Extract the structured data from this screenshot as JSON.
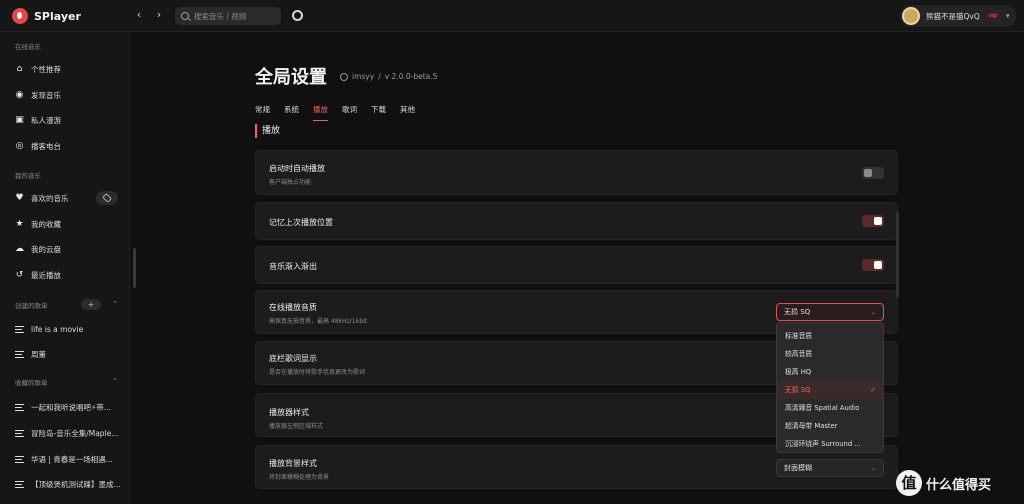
{
  "app": {
    "name": "SPlayer"
  },
  "search": {
    "placeholder": "搜索音乐 / 视频"
  },
  "user": {
    "name": "熊猫不是猫QvQ",
    "badge": "vip"
  },
  "sidebar": {
    "online_title": "在线音乐",
    "online_items": [
      {
        "label": "个性推荐",
        "icon": "home-icon"
      },
      {
        "label": "发现音乐",
        "icon": "compass-icon"
      },
      {
        "label": "私人漫游",
        "icon": "radio-icon"
      },
      {
        "label": "播客电台",
        "icon": "podcast-icon"
      }
    ],
    "mine_title": "我的音乐",
    "mine_items": [
      {
        "label": "喜欢的音乐",
        "icon": "heart-icon"
      },
      {
        "label": "我的收藏",
        "icon": "star-icon"
      },
      {
        "label": "我的云盘",
        "icon": "cloud-icon"
      },
      {
        "label": "最近播放",
        "icon": "history-icon"
      }
    ],
    "created_title": "创建的歌单",
    "created_items": [
      {
        "label": "life is a movie"
      },
      {
        "label": "周董"
      }
    ],
    "collected_title": "收藏的歌单",
    "collected_items": [
      {
        "label": "一起和我听说唱吧⚡带..."
      },
      {
        "label": "冒险岛-音乐全集/Maple..."
      },
      {
        "label": "华语 | 青春是一场相遇..."
      },
      {
        "label": "【顶级煲机测试碟】墨成..."
      }
    ]
  },
  "page": {
    "title": "全局设置",
    "author": "imsyy",
    "version": "v 2.0.0-beta.5",
    "tabs": [
      "常规",
      "系统",
      "播放",
      "歌词",
      "下载",
      "其他"
    ],
    "active_tab": 2,
    "section": "播放"
  },
  "settings": [
    {
      "title": "启动时自动播放",
      "desc": "客户端独占功能",
      "toggle": false
    },
    {
      "title": "记忆上次播放位置",
      "toggle": true
    },
    {
      "title": "音乐渐入渐出",
      "toggle": true
    },
    {
      "title": "在线播放音质",
      "desc": "高保真无损音质，最高 48kHz/16bit",
      "select": "无损 SQ"
    },
    {
      "title": "底栏歌词显示",
      "desc": "是否在播放时将歌手信息更改为歌词"
    },
    {
      "title": "播放器样式",
      "desc": "播放器左侧区域样式"
    },
    {
      "title": "播放背景样式",
      "desc": "将封面模糊处理为背景",
      "select": "封面模糊"
    }
  ],
  "quality_options": [
    "标准音质",
    "较高音质",
    "极高 HQ",
    "无损 SQ",
    "高清臻音 Spatial Audio",
    "超清母带 Master",
    "沉浸环绕声 Surround ..."
  ],
  "quality_selected": 3,
  "watermark": {
    "glyph": "值",
    "text": "什么值得买"
  },
  "colors": {
    "accent": "#ff5b5b",
    "background": "#101010",
    "card": "#1c1c1c"
  }
}
